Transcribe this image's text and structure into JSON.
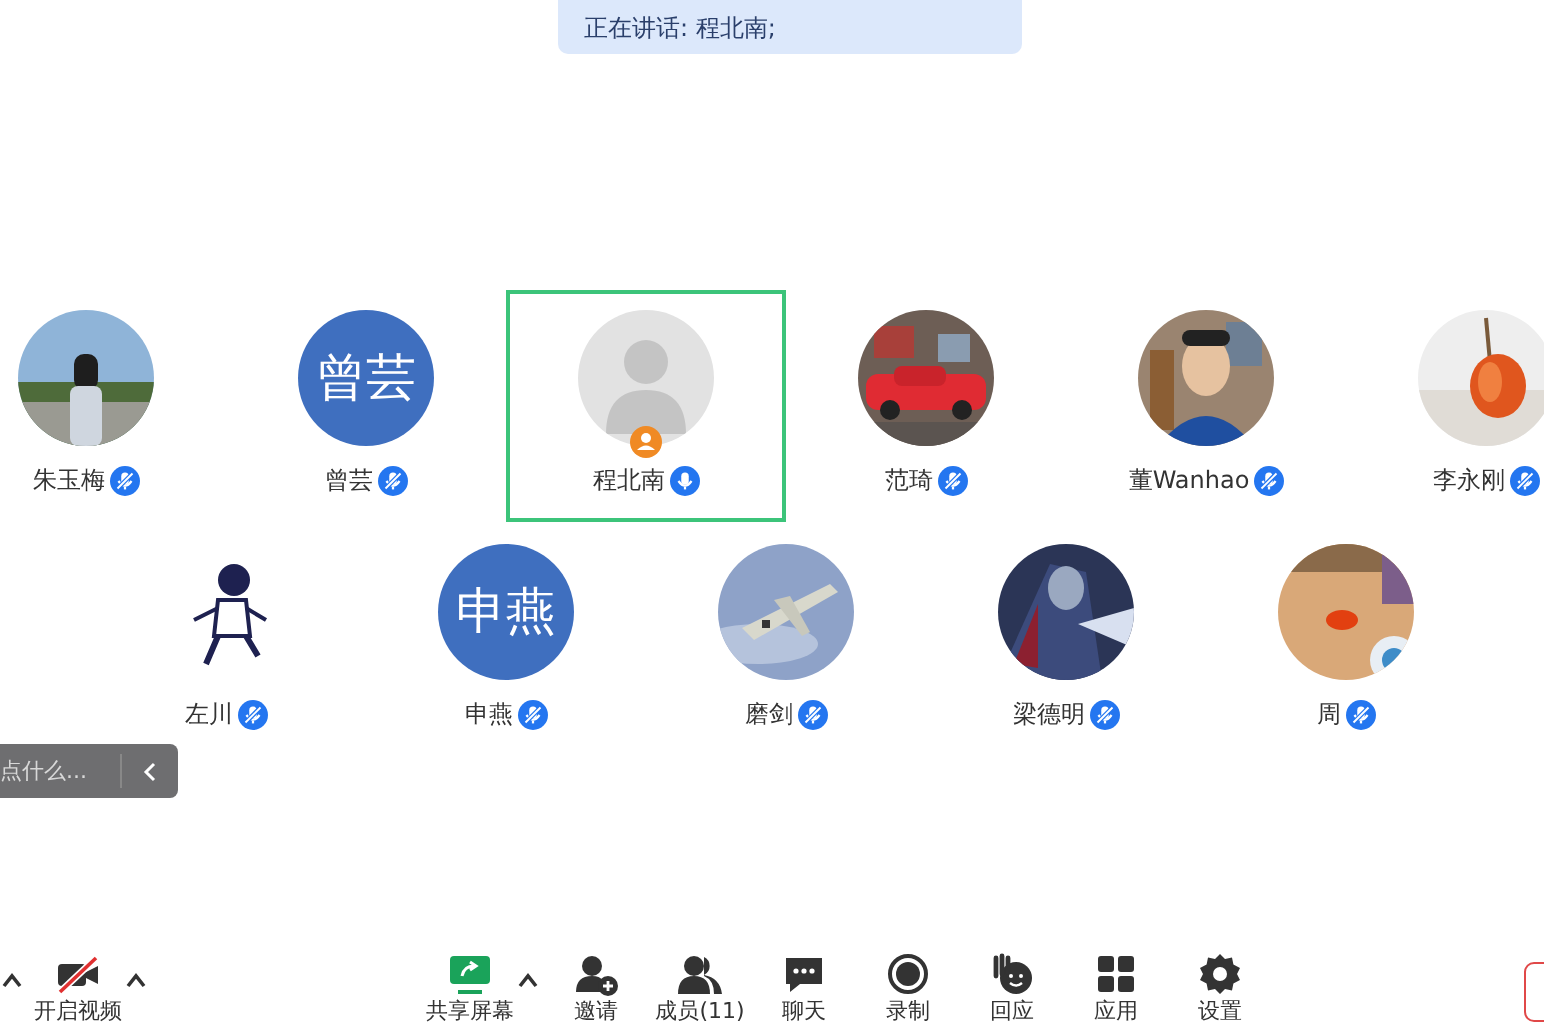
{
  "speaking_banner": {
    "text": "正在讲话: 程北南;"
  },
  "participant_rows": [
    {
      "participants": [
        {
          "name": "朱玉梅",
          "muted": true,
          "speaking": false,
          "host": false
        },
        {
          "name": "曾芸",
          "avatar": {
            "kind": "initials",
            "text": "曾芸"
          },
          "muted": true,
          "speaking": false,
          "host": false
        },
        {
          "name": "程北南",
          "avatar": {
            "kind": "default"
          },
          "muted": false,
          "speaking": true,
          "host": true
        },
        {
          "name": "范琦",
          "muted": true,
          "speaking": false,
          "host": false
        },
        {
          "name": "董Wanhao",
          "muted": true,
          "speaking": false,
          "host": false
        },
        {
          "name": "李永刚",
          "muted": true,
          "speaking": false,
          "host": false
        }
      ]
    },
    {
      "participants": [
        {
          "name": "左川",
          "muted": true,
          "speaking": false,
          "host": false
        },
        {
          "name": "申燕",
          "avatar": {
            "kind": "initials",
            "text": "申燕"
          },
          "muted": true,
          "speaking": false,
          "host": false
        },
        {
          "name": "磨剑",
          "muted": true,
          "speaking": false,
          "host": false
        },
        {
          "name": "梁德明",
          "muted": true,
          "speaking": false,
          "host": false
        },
        {
          "name": "周",
          "muted": true,
          "speaking": false,
          "host": false
        }
      ]
    }
  ],
  "chat_box": {
    "placeholder": "点什么..."
  },
  "toolbar": [
    {
      "kind": "menu-caret"
    },
    {
      "kind": "video",
      "label": "开启视频",
      "off": true,
      "has_menu": true
    },
    {
      "kind": "share",
      "label": "共享屏幕",
      "has_menu": true
    },
    {
      "kind": "invite",
      "label": "邀请"
    },
    {
      "kind": "members",
      "label": "成员(11)"
    },
    {
      "kind": "chat",
      "label": "聊天"
    },
    {
      "kind": "record",
      "label": "录制"
    },
    {
      "kind": "reactions",
      "label": "回应"
    },
    {
      "kind": "apps",
      "label": "应用"
    },
    {
      "kind": "settings",
      "label": "设置"
    },
    {
      "kind": "leave"
    }
  ]
}
